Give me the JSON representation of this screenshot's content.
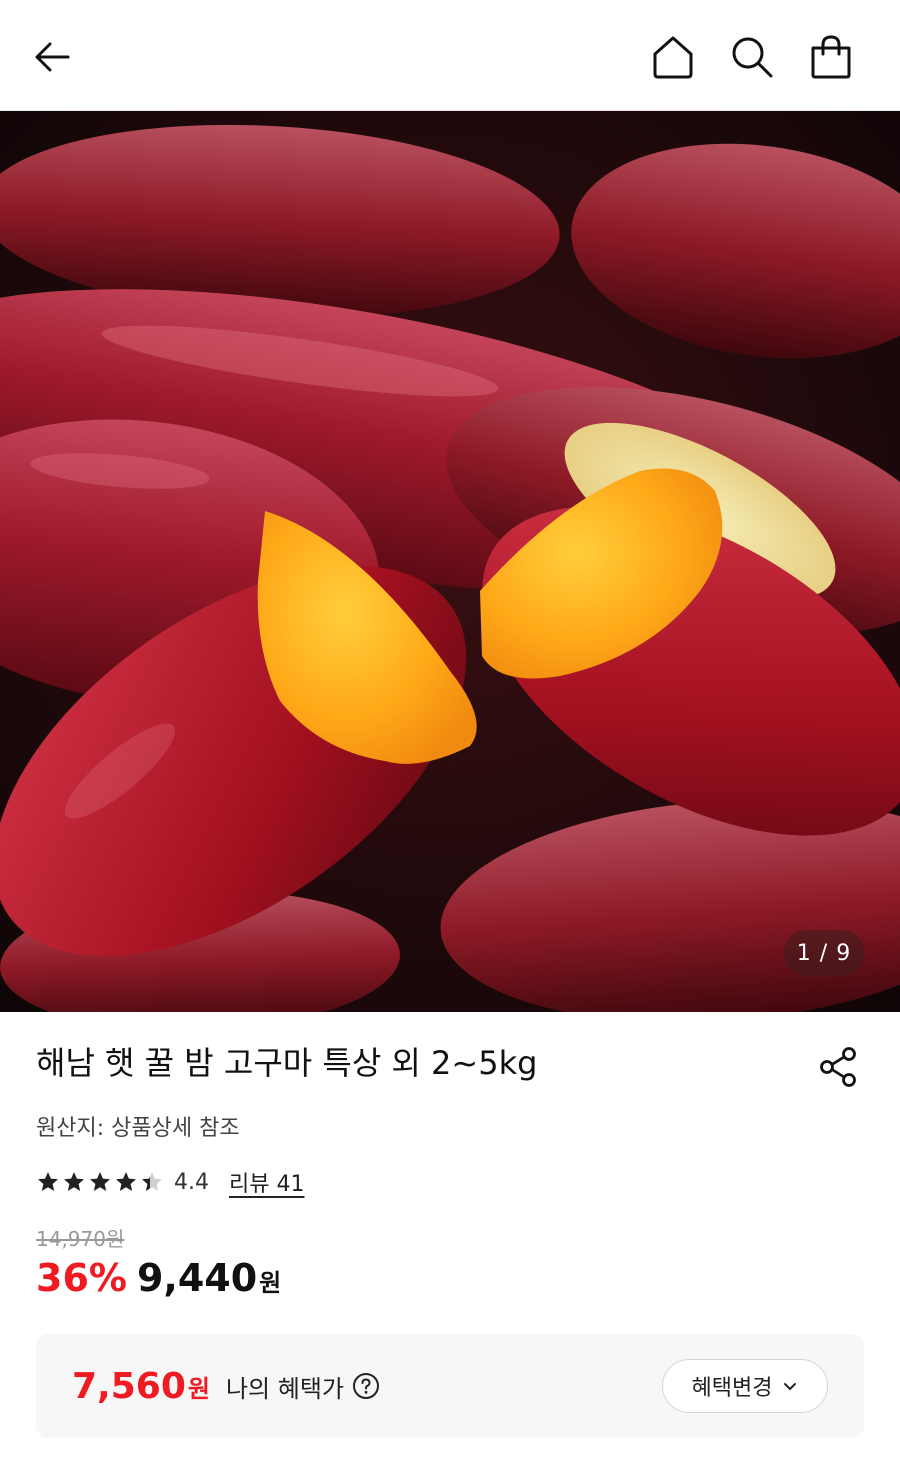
{
  "product": {
    "title": "해남 햇 꿀 밤 고구마 특상 외 2~5kg",
    "origin": "원산지: 상품상세 참조",
    "rating": 4.4,
    "rating_text": "4.4",
    "review_link": "리뷰 41",
    "original_price": "14,970원",
    "discount": "36%",
    "price": "9,440",
    "price_unit": "원"
  },
  "gallery": {
    "counter": "1 / 9",
    "current": 1,
    "total": 9
  },
  "benefit": {
    "price": "7,560",
    "unit": "원",
    "label": "나의 혜택가",
    "button_label": "혜택변경"
  },
  "icons": {
    "back": "back-arrow-icon",
    "home": "home-icon",
    "search": "search-icon",
    "cart": "shopping-bag-icon",
    "share": "share-icon",
    "help": "question-circle-icon",
    "chevron": "chevron-down-icon"
  },
  "colors": {
    "accent": "#ef1a22",
    "card_bg": "#f7f7f7"
  }
}
